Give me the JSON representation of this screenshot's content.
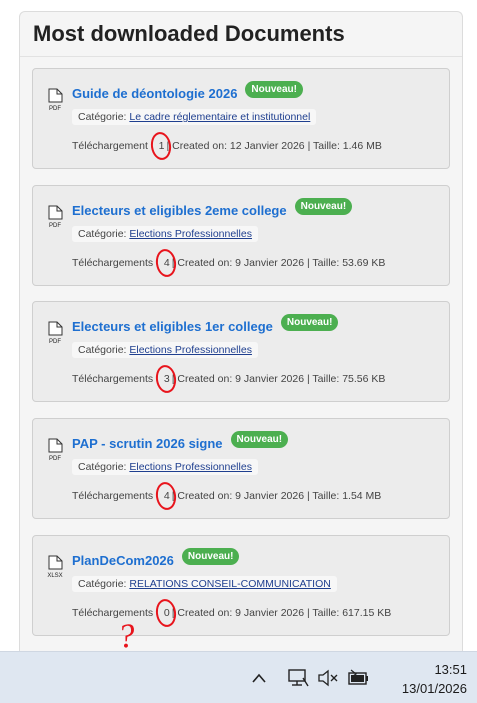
{
  "panel": {
    "title": "Most downloaded Documents"
  },
  "documents": [
    {
      "type": "PDF",
      "title": "Guide de déontologie 2026",
      "badge": "Nouveau!",
      "category_label": "Catégorie:",
      "category": "Le cadre réglementaire et institutionnel",
      "downloads_label": "Téléchargement :",
      "downloads": "1",
      "created_label": "| Created on: ",
      "created": "12 Janvier 2026",
      "size_label": " | Taille: ",
      "size": "1.46 MB"
    },
    {
      "type": "PDF",
      "title": "Electeurs et eligibles 2eme college",
      "badge": "Nouveau!",
      "category_label": "Catégorie:",
      "category": "Elections Professionnelles",
      "downloads_label": "Téléchargements :",
      "downloads": "4",
      "created_label": "| Created on: ",
      "created": "9 Janvier 2026",
      "size_label": " | Taille: ",
      "size": "53.69 KB"
    },
    {
      "type": "PDF",
      "title": "Electeurs et eligibles 1er college",
      "badge": "Nouveau!",
      "category_label": "Catégorie:",
      "category": "Elections Professionnelles",
      "downloads_label": "Téléchargements :",
      "downloads": "3",
      "created_label": "| Created on: ",
      "created": "9 Janvier 2026",
      "size_label": " | Taille: ",
      "size": "75.56 KB"
    },
    {
      "type": "PDF",
      "title": "PAP - scrutin 2026 signe",
      "badge": "Nouveau!",
      "category_label": "Catégorie:",
      "category": "Elections Professionnelles",
      "downloads_label": "Téléchargements :",
      "downloads": "4",
      "created_label": "| Created on: ",
      "created": "9 Janvier 2026",
      "size_label": " | Taille: ",
      "size": "1.54 MB"
    },
    {
      "type": "XLSX",
      "title": "PlanDeCom2026",
      "badge": "Nouveau!",
      "category_label": "Catégorie:",
      "category": "RELATIONS CONSEIL-COMMUNICATION",
      "downloads_label": "Téléchargements :",
      "downloads": "0",
      "created_label": "| Created on: ",
      "created": "9 Janvier 2026",
      "size_label": " | Taille: ",
      "size": "617.15 KB"
    }
  ],
  "annotation": {
    "mark": "?"
  },
  "taskbar": {
    "icons": [
      "chevron-up-icon",
      "network-icon",
      "speaker-muted-icon",
      "battery-charging-icon"
    ],
    "time": "13:51",
    "date": "13/01/2026"
  },
  "colors": {
    "link": "#1e6fd0",
    "badge": "#4caf50",
    "annotation": "#e8141c",
    "taskbar": "#dfe7f1"
  }
}
